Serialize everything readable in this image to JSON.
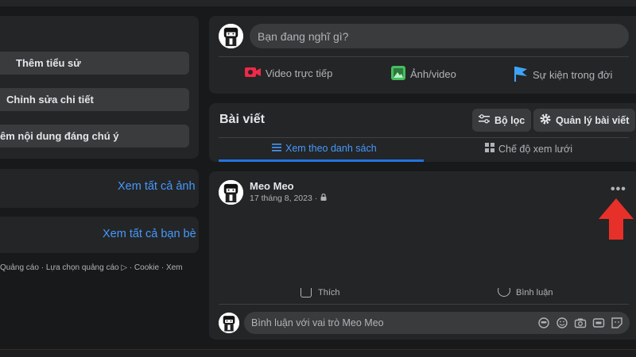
{
  "sidebar": {
    "buttons": [
      "Thêm tiểu sử",
      "Chỉnh sửa chi tiết",
      "êm nội dung đáng chú ý"
    ],
    "photos_link": "Xem tất cả ảnh",
    "friends_link": "Xem tất cả bạn bè",
    "footer": "Quảng cáo · Lựa chọn quảng cáo ▷ · Cookie · Xem"
  },
  "composer": {
    "placeholder": "Bạn đang nghĩ gì?",
    "actions": [
      {
        "label": "Video trực tiếp",
        "icon": "live-video-icon",
        "color": "#f02849"
      },
      {
        "label": "Ảnh/video",
        "icon": "photo-icon",
        "color": "#45bd62"
      },
      {
        "label": "Sự kiện trong đời",
        "icon": "flag-icon",
        "color": "#3ea3f7"
      }
    ]
  },
  "posts": {
    "title": "Bài viết",
    "filter_label": "Bộ lọc",
    "manage_label": "Quản lý bài viết",
    "tabs": [
      {
        "label": "Xem theo danh sách",
        "active": true
      },
      {
        "label": "Chế độ xem lưới",
        "active": false
      }
    ]
  },
  "post": {
    "author": "Meo Meo",
    "date": "17 tháng 8, 2023 ·",
    "more": "•••",
    "reactions": [
      "Thích",
      "Bình luận"
    ],
    "comment_placeholder": "Bình luận với vai trò Meo Meo"
  },
  "colors": {
    "accent": "#2374e1",
    "link": "#4599ff",
    "annotation_arrow": "#e8302a"
  }
}
